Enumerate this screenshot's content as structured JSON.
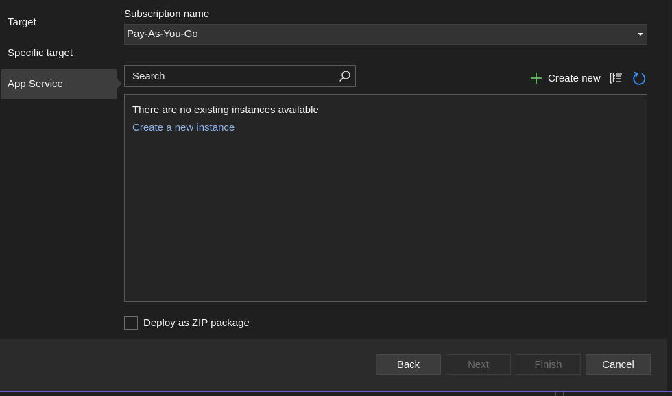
{
  "nav": {
    "items": [
      {
        "label": "Target",
        "selected": false
      },
      {
        "label": "Specific target",
        "selected": false
      },
      {
        "label": "App Service",
        "selected": true
      }
    ]
  },
  "subscription": {
    "label": "Subscription name",
    "value": "Pay-As-You-Go"
  },
  "search": {
    "placeholder": "Search",
    "icon": "search-icon"
  },
  "toolbar": {
    "create_new_label": "Create new",
    "icons": [
      "plus-icon",
      "tree-view-icon",
      "refresh-icon"
    ]
  },
  "instances": {
    "empty_message": "There are no existing instances available",
    "create_link": "Create a new instance"
  },
  "options": {
    "zip_label": "Deploy as ZIP package",
    "zip_checked": false
  },
  "footer": {
    "back_label": "Back",
    "next_label": "Next",
    "finish_label": "Finish",
    "cancel_label": "Cancel"
  },
  "colors": {
    "background": "#1f1f1f",
    "selected_nav": "#3d3d3d",
    "link": "#8bb4e8",
    "accent_green": "#6ccf6c",
    "refresh_blue": "#3794ff",
    "footer": "#2b2b2b"
  }
}
